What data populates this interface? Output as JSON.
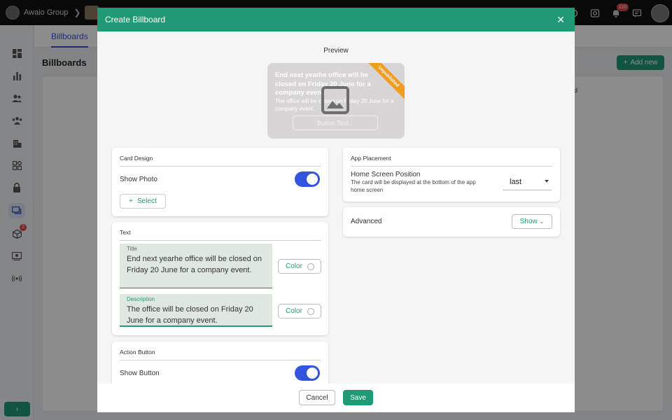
{
  "topbar": {
    "org_name": "Awaio Group",
    "notification_count": "110"
  },
  "sidebar": {
    "active_item": "billboards",
    "inbox_badge": "2"
  },
  "tabbar": {
    "active_tab": "Billboards"
  },
  "page": {
    "title": "Billboards",
    "add_new_label": "Add new",
    "table_header_fragment": "d"
  },
  "modal": {
    "title": "Create Billboard",
    "preview": {
      "label": "Preview",
      "card_title": "End next yearhe office will be closed on Friday 20 June for a company event.",
      "card_description": "The office will be closed on Friday 20 June for a company event.",
      "button_text": "Button Text...",
      "ribbon": "Unpublished"
    },
    "card_design": {
      "header": "Card Design",
      "show_photo_label": "Show Photo",
      "show_photo_on": true,
      "select_label": "Select"
    },
    "text_section": {
      "header": "Text",
      "title_label": "Title",
      "title_value": "End next yearhe office will be closed on Friday 20 June for a company event.",
      "description_label": "Description",
      "description_value": "The office will be closed on Friday 20 June for a company event.",
      "color_label": "Color"
    },
    "action_button": {
      "header": "Action Button",
      "show_button_label": "Show Button",
      "show_button_on": true
    },
    "app_placement": {
      "header": "App Placement",
      "position_label": "Home Screen Position",
      "position_help": "The card will be displayed at the bottom of the app home screen",
      "position_value": "last"
    },
    "advanced": {
      "label": "Advanced",
      "show_label": "Show"
    },
    "footer": {
      "cancel_label": "Cancel",
      "save_label": "Save"
    }
  },
  "colors": {
    "brand_green": "#1f9a74",
    "accent_blue": "#3355dd",
    "ribbon_orange": "#f29c1e",
    "badge_red": "#e04545"
  }
}
